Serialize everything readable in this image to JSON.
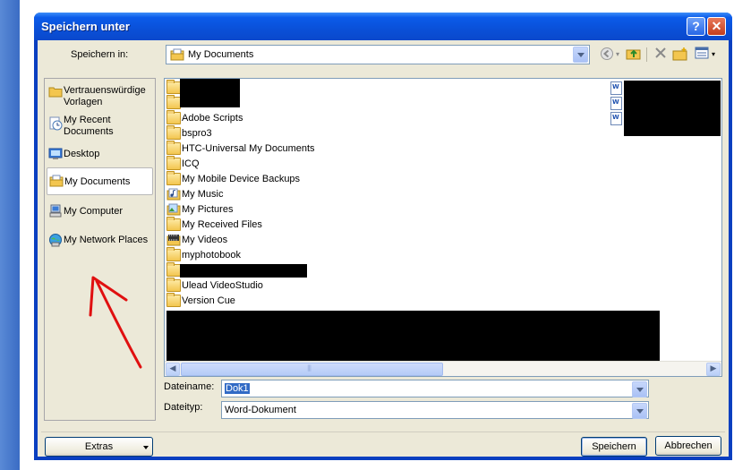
{
  "window": {
    "title": "Speichern unter",
    "help_glyph": "?",
    "close_glyph": "✕"
  },
  "lookin": {
    "label": "Speichern in:",
    "value": "My Documents"
  },
  "places": [
    {
      "label": "Vertrauenswürdige Vorlagen",
      "icon": "folder-icon"
    },
    {
      "label": "My Recent Documents",
      "icon": "recent-documents-icon"
    },
    {
      "label": "Desktop",
      "icon": "desktop-icon"
    },
    {
      "label": "My Documents",
      "icon": "my-documents-icon",
      "selected": true
    },
    {
      "label": "My Computer",
      "icon": "computer-icon"
    },
    {
      "label": "My Network Places",
      "icon": "network-places-icon"
    }
  ],
  "files": [
    {
      "name": "",
      "icon": "folder-icon",
      "redacted": true
    },
    {
      "name": "",
      "icon": "folder-icon",
      "redacted": true
    },
    {
      "name": "Adobe Scripts",
      "icon": "folder-icon"
    },
    {
      "name": "bspro3",
      "icon": "folder-icon"
    },
    {
      "name": "HTC-Universal My Documents",
      "icon": "folder-icon"
    },
    {
      "name": "ICQ",
      "icon": "folder-icon"
    },
    {
      "name": "My Mobile Device Backups",
      "icon": "folder-icon"
    },
    {
      "name": "My Music",
      "icon": "music-folder-icon"
    },
    {
      "name": "My Pictures",
      "icon": "pictures-folder-icon"
    },
    {
      "name": "My Received Files",
      "icon": "folder-icon"
    },
    {
      "name": "My Videos",
      "icon": "videos-folder-icon"
    },
    {
      "name": "myphotobook",
      "icon": "folder-icon"
    },
    {
      "name": "",
      "icon": "folder-icon",
      "redacted": true
    },
    {
      "name": "Ulead VideoStudio",
      "icon": "folder-icon"
    },
    {
      "name": "Version Cue",
      "icon": "folder-icon"
    }
  ],
  "filename": {
    "label": "Dateiname:",
    "value": "Dok1"
  },
  "filetype": {
    "label": "Dateityp:",
    "value": "Word-Dokument"
  },
  "buttons": {
    "extras": "Extras",
    "save": "Speichern",
    "cancel": "Abbrechen"
  },
  "colors": {
    "titlebar": "#0a50d8",
    "dialog_bg": "#ece9d8",
    "selection": "#316ac5",
    "annotation_arrow": "#e01010"
  }
}
